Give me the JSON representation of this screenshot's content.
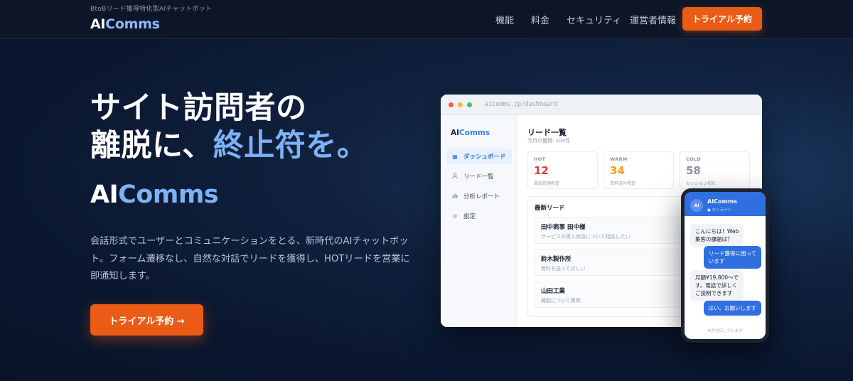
{
  "header": {
    "tagline": "BtoBリード獲得特化型AIチャットボット",
    "logo_a": "AI",
    "logo_b": "Comms",
    "nav": [
      "機能",
      "料金",
      "セキュリティ",
      "運営者情報"
    ],
    "cta": "トライアル予約"
  },
  "hero": {
    "title_line1": "サイト訪問者の",
    "title_line2_a": "離脱に、",
    "title_line2_b": "終止符を。",
    "brand_a": "AI",
    "brand_b": "Comms",
    "description": "会話形式でユーザーとコミュニケーションをとる、新時代のAIチャットボット。フォーム遷移なし、自然な対話でリードを獲得し、HOTリードを営業に即通知します。",
    "cta": "トライアル予約 →"
  },
  "dashboard": {
    "url": "aicomms.jp/dashboard",
    "logo_a": "AI",
    "logo_b": "Comms",
    "sidebar": [
      {
        "icon": "grid-icon",
        "label": "ダッシュボード",
        "active": true
      },
      {
        "icon": "person-icon",
        "label": "リード一覧",
        "active": false
      },
      {
        "icon": "chart-icon",
        "label": "分析レポート",
        "active": false
      },
      {
        "icon": "gear-icon",
        "label": "設定",
        "active": false
      }
    ],
    "title": "リード一覧",
    "subtitle": "今月の獲得: 104件",
    "stats": [
      {
        "label": "HOT",
        "value": "12",
        "note": "電話説明希望",
        "color": "#e0393e"
      },
      {
        "label": "WARM",
        "value": "34",
        "note": "資料送付希望",
        "color": "#f0a020"
      },
      {
        "label": "COLD",
        "value": "58",
        "note": "セッション切れ",
        "color": "#8a94a6"
      }
    ],
    "latest_heading": "最新リード",
    "leads": [
      {
        "name": "田中商事 田中様",
        "message": "サービスの導入商談について相談したい"
      },
      {
        "name": "鈴木製作所",
        "message": "資料を送ってほしい"
      },
      {
        "name": "山田工業",
        "message": "機能について質問"
      }
    ]
  },
  "phone": {
    "avatar": "AI",
    "name": "AIComms",
    "status": "● オンライン",
    "messages": [
      {
        "from": "bot",
        "lines": [
          "こんにちは！Web",
          "集客の課題は？"
        ]
      },
      {
        "from": "user",
        "lines": [
          "リード獲得に困って",
          "います"
        ]
      },
      {
        "from": "bot",
        "lines": [
          "月額¥19,800〜で",
          "す。電話で詳しく",
          "ご説明できます"
        ]
      },
      {
        "from": "user",
        "lines": [
          "はい、お願いします"
        ]
      }
    ],
    "footer": "AIが対応しています"
  },
  "colors": {
    "accent": "#ea5b16",
    "highlight": "#7fb1f7",
    "primary_blue": "#2f6fe0"
  }
}
